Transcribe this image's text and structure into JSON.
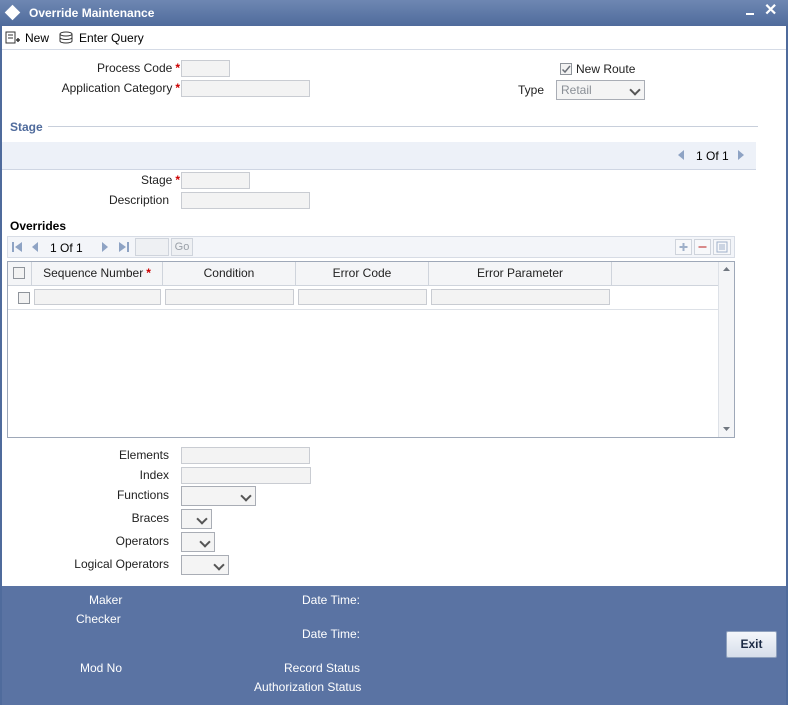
{
  "window": {
    "title": "Override Maintenance"
  },
  "toolbar": {
    "new_label": "New",
    "enter_query_label": "Enter Query"
  },
  "header": {
    "process_code_label": "Process Code",
    "application_category_label": "Application Category",
    "required_mark": "*",
    "new_route_label": "New Route",
    "new_route_checked": true,
    "type_label": "Type",
    "type_value": "Retail"
  },
  "stage": {
    "section_title": "Stage",
    "pager": "1 Of 1",
    "stage_label": "Stage",
    "description_label": "Description"
  },
  "overrides": {
    "section_title": "Overrides",
    "pager": "1 Of 1",
    "go_label": "Go",
    "columns": [
      "Sequence Number",
      "Condition",
      "Error Code",
      "Error Parameter"
    ]
  },
  "expression": {
    "elements_label": "Elements",
    "index_label": "Index",
    "functions_label": "Functions",
    "braces_label": "Braces",
    "operators_label": "Operators",
    "logical_operators_label": "Logical Operators"
  },
  "footer": {
    "maker_label": "Maker",
    "checker_label": "Checker",
    "date_time_label_1": "Date Time:",
    "date_time_label_2": "Date Time:",
    "mod_no_label": "Mod No",
    "record_status_label": "Record Status",
    "authorization_status_label": "Authorization Status",
    "exit_label": "Exit"
  },
  "colors": {
    "title_bar": "#4f6b9c",
    "footer_bg": "#5a73a3",
    "required": "#cc0000"
  }
}
